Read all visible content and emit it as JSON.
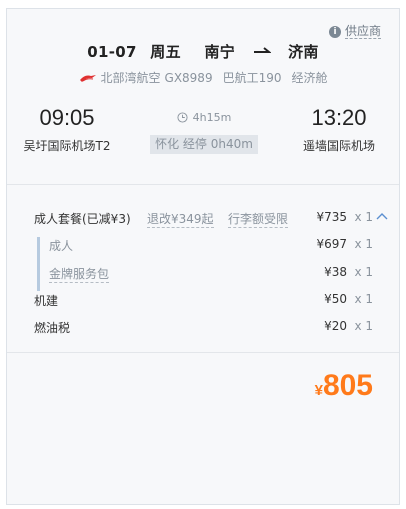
{
  "supplier": {
    "label": "供应商",
    "icon": "info-icon"
  },
  "route": {
    "date": "01-07",
    "weekday": "周五",
    "from_city": "南宁",
    "to_city": "济南"
  },
  "airline": {
    "name": "北部湾航空",
    "flight_no": "GX8989",
    "aircraft": "巴航工190",
    "cabin": "经济舱"
  },
  "departure": {
    "time": "09:05",
    "airport": "吴圩国际机场T2"
  },
  "arrival": {
    "time": "13:20",
    "airport": "遥墙国际机场"
  },
  "middle": {
    "duration": "4h15m",
    "stop": "怀化 经停 0h40m"
  },
  "price": {
    "package": {
      "label": "成人套餐(已减¥3)",
      "refund": "退改¥349起",
      "baggage": "行李额受限",
      "amount": "¥735",
      "qty": "x 1"
    },
    "adult": {
      "label": "成人",
      "amount": "¥697",
      "qty": "x 1"
    },
    "gold_service": {
      "label": "金牌服务包",
      "amount": "¥38",
      "qty": "x 1"
    },
    "airport_tax": {
      "label": "机建",
      "amount": "¥50",
      "qty": "x 1"
    },
    "fuel_tax": {
      "label": "燃油税",
      "amount": "¥20",
      "qty": "x 1"
    }
  },
  "total": {
    "currency": "¥",
    "value": "805"
  },
  "colors": {
    "accent": "#ff7a1a",
    "sub_bar": "#b6cadf"
  }
}
